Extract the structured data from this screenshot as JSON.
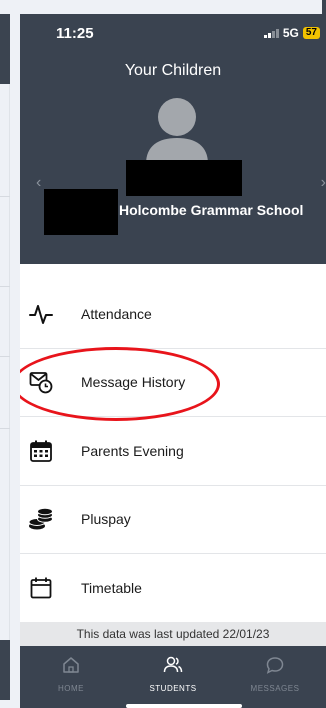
{
  "status_bar": {
    "time": "11:25",
    "network": "5G",
    "battery": "57"
  },
  "header": {
    "title": "Your Children",
    "school": "Holcombe Grammar School"
  },
  "menu": {
    "items": [
      {
        "label": "Attendance",
        "icon": "pulse-icon"
      },
      {
        "label": "Message History",
        "icon": "mail-clock-icon"
      },
      {
        "label": "Parents Evening",
        "icon": "calendar-grid-icon"
      },
      {
        "label": "Pluspay",
        "icon": "coins-icon"
      },
      {
        "label": "Timetable",
        "icon": "calendar-icon"
      }
    ]
  },
  "footer_note": "This data was last updated 22/01/23",
  "tabbar": {
    "tabs": [
      {
        "label": "HOME",
        "icon": "home-icon",
        "active": false
      },
      {
        "label": "STUDENTS",
        "icon": "users-icon",
        "active": true
      },
      {
        "label": "MESSAGES",
        "icon": "chat-bubble-icon",
        "active": false
      }
    ]
  },
  "colors": {
    "header": "#3a4350",
    "highlight": "#e8141b",
    "battery": "#f2c200"
  }
}
